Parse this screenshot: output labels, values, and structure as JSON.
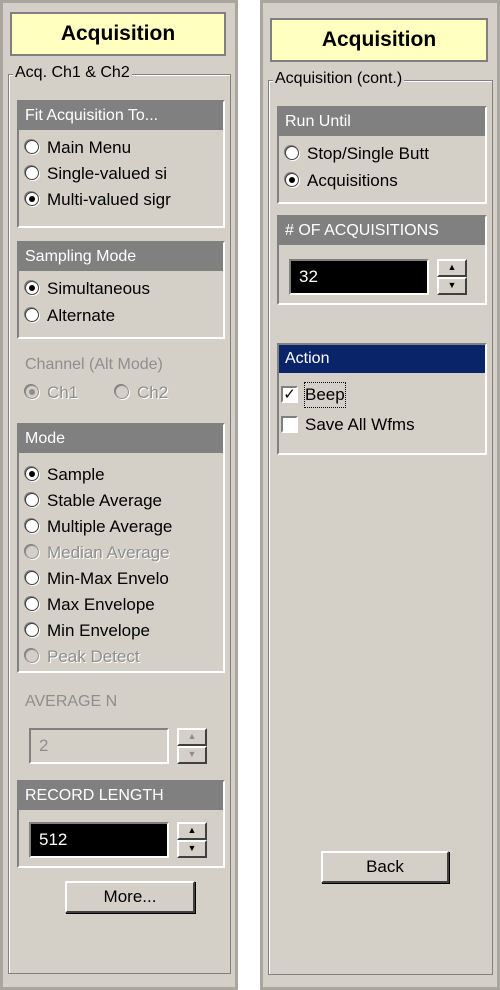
{
  "left": {
    "title": "Acquisition",
    "group_label": "Acq. Ch1 & Ch2",
    "fit": {
      "header": "Fit Acquisition To...",
      "options": [
        "Main Menu",
        "Single-valued si",
        "Multi-valued sigr"
      ],
      "selected": "Multi-valued sigr"
    },
    "sampling": {
      "header": "Sampling Mode",
      "options": [
        "Simultaneous",
        "Alternate"
      ],
      "selected": "Simultaneous"
    },
    "channel": {
      "header": "Channel (Alt Mode)",
      "options": [
        "Ch1",
        "Ch2"
      ],
      "selected": "Ch1",
      "disabled": true
    },
    "mode": {
      "header": "Mode",
      "options": [
        "Sample",
        "Stable Average",
        "Multiple Average",
        "Median Average",
        "Min-Max Envelo",
        "Max Envelope",
        "Min Envelope",
        "Peak Detect"
      ],
      "disabled_options": [
        "Median Average",
        "Peak Detect"
      ],
      "selected": "Sample"
    },
    "average_n": {
      "header": "AVERAGE N",
      "value": "2",
      "disabled": true
    },
    "record_length": {
      "header": "RECORD LENGTH",
      "value": "512"
    },
    "more_button": "More..."
  },
  "right": {
    "title": "Acquisition",
    "group_label": "Acquisition (cont.)",
    "run_until": {
      "header": "Run Until",
      "options": [
        "Stop/Single Butt",
        "Acquisitions"
      ],
      "selected": "Acquisitions"
    },
    "num_acq": {
      "header": "# OF ACQUISITIONS",
      "value": "32"
    },
    "action": {
      "header": "Action",
      "checks": [
        {
          "label": "Beep",
          "checked": true
        },
        {
          "label": "Save All Wfms",
          "checked": false
        }
      ]
    },
    "back_button": "Back"
  },
  "colors": {
    "panel_bg": "#d4d0c8",
    "title_bg": "#ffffc0",
    "section_header": "#808080",
    "active_header": "#0a246a",
    "field_bg": "#000000"
  }
}
